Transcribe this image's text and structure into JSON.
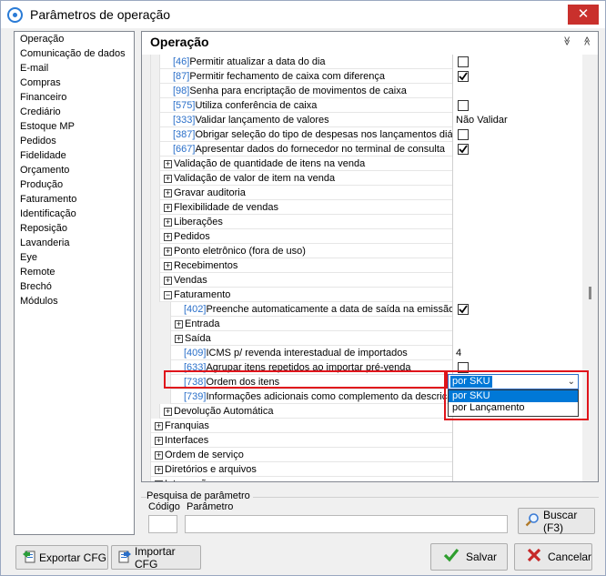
{
  "window": {
    "title": "Parâmetros de operação",
    "close_glyph": "✕"
  },
  "categories": [
    "Operação",
    "Comunicação de dados",
    "E-mail",
    "Compras",
    "Financeiro",
    "Crediário",
    "Estoque MP",
    "Pedidos",
    "Fidelidade",
    "Orçamento",
    "Produção",
    "Faturamento",
    "Identificação",
    "Reposição",
    "Lavanderia",
    "Eye",
    "Remote",
    "Brechó",
    "Módulos"
  ],
  "panel": {
    "title": "Operação",
    "collapse_all": "≫",
    "expand_all": "≪"
  },
  "rows": [
    {
      "level": 1,
      "type": "param",
      "code": "[46]",
      "label": "Permitir atualizar a data do dia",
      "value_type": "check",
      "checked": false
    },
    {
      "level": 1,
      "type": "param",
      "code": "[87]",
      "label": "Permitir fechamento de caixa com diferença",
      "value_type": "check",
      "checked": true
    },
    {
      "level": 1,
      "type": "param",
      "code": "[98]",
      "label": "Senha para encriptação de movimentos de caixa",
      "value_type": "none"
    },
    {
      "level": 1,
      "type": "param",
      "code": "[575]",
      "label": "Utiliza conferência de caixa",
      "value_type": "check",
      "checked": false
    },
    {
      "level": 1,
      "type": "param",
      "code": "[333]",
      "label": "Validar lançamento de valores",
      "value_type": "text",
      "value": "Não Validar"
    },
    {
      "level": 1,
      "type": "param",
      "code": "[387]",
      "label": "Obrigar seleção do tipo de despesas nos lançamentos diári",
      "value_type": "check",
      "checked": false
    },
    {
      "level": 1,
      "type": "param",
      "code": "[667]",
      "label": "Apresentar dados do fornecedor no terminal de consulta",
      "value_type": "check",
      "checked": true
    },
    {
      "level": 1,
      "type": "group",
      "label": "Validação de quantidade de itens na venda",
      "expander": "+"
    },
    {
      "level": 1,
      "type": "group",
      "label": "Validação de valor de item na venda",
      "expander": "+"
    },
    {
      "level": 1,
      "type": "group",
      "label": "Gravar auditoria",
      "expander": "+"
    },
    {
      "level": 1,
      "type": "group",
      "label": "Flexibilidade de vendas",
      "expander": "+"
    },
    {
      "level": 1,
      "type": "group",
      "label": "Liberações",
      "expander": "+"
    },
    {
      "level": 1,
      "type": "group",
      "label": "Pedidos",
      "expander": "+"
    },
    {
      "level": 1,
      "type": "group",
      "label": "Ponto eletrônico (fora de uso)",
      "expander": "+"
    },
    {
      "level": 1,
      "type": "group",
      "label": "Recebimentos",
      "expander": "+"
    },
    {
      "level": 1,
      "type": "group",
      "label": "Vendas",
      "expander": "+"
    },
    {
      "level": 1,
      "type": "group",
      "label": "Faturamento",
      "expander": "−"
    },
    {
      "level": 2,
      "type": "param",
      "code": "[402]",
      "label": "Preenche automaticamente a data de saída na emissão",
      "value_type": "check",
      "checked": true
    },
    {
      "level": 2,
      "type": "group",
      "label": "Entrada",
      "expander": "+"
    },
    {
      "level": 2,
      "type": "group",
      "label": "Saída",
      "expander": "+"
    },
    {
      "level": 2,
      "type": "param",
      "code": "[409]",
      "label": "ICMS p/ revenda interestadual de importados",
      "value_type": "text",
      "value": "4"
    },
    {
      "level": 2,
      "type": "param",
      "code": "[633]",
      "label": "Agrupar itens repetidos ao importar pré-venda",
      "value_type": "check",
      "checked": false
    },
    {
      "level": 2,
      "type": "param",
      "code": "[738]",
      "label": "Ordem dos itens",
      "value_type": "none"
    },
    {
      "level": 2,
      "type": "param",
      "code": "[739]",
      "label": "Informações adicionais como complemento da descrição",
      "value_type": "none"
    },
    {
      "level": 1,
      "type": "group",
      "label": "Devolução Automática",
      "expander": "+"
    },
    {
      "level": 0,
      "type": "group",
      "label": "Franquias",
      "expander": "+"
    },
    {
      "level": 0,
      "type": "group",
      "label": "Interfaces",
      "expander": "+"
    },
    {
      "level": 0,
      "type": "group",
      "label": "Ordem de serviço",
      "expander": "+"
    },
    {
      "level": 0,
      "type": "group",
      "label": "Diretórios e arquivos",
      "expander": "+"
    },
    {
      "level": 0,
      "type": "group",
      "label": "Integrações",
      "expander": "+"
    }
  ],
  "dropdown": {
    "value": "por SKU",
    "options": [
      "por SKU",
      "por Lançamento"
    ],
    "selected_index": 0,
    "arrow": "⌄"
  },
  "search": {
    "group_title": "Pesquisa de parâmetro",
    "code_label": "Código",
    "param_label": "Parâmetro",
    "code_value": "",
    "param_value": "",
    "button": "Buscar (F3)"
  },
  "buttons": {
    "export": "Exportar CFG",
    "import": "Importar CFG",
    "save": "Salvar",
    "cancel": "Cancelar"
  },
  "colors": {
    "code_blue": "#2a6fc9",
    "highlight_red": "#e0141b",
    "selection_blue": "#0078d7",
    "save_green": "#2e9e2e",
    "cancel_red": "#c62828"
  }
}
